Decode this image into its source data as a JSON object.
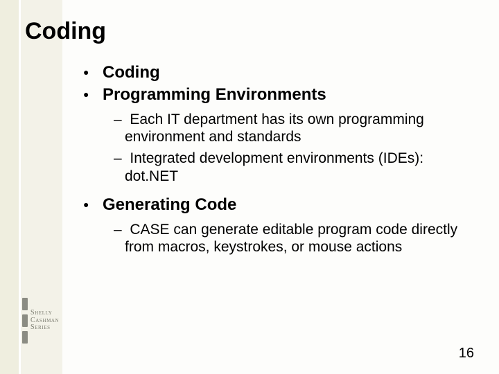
{
  "slide": {
    "title": "Coding",
    "bullets": [
      {
        "text": "Coding",
        "sub": []
      },
      {
        "text": "Programming Environments",
        "sub": [
          "Each IT department has its own programming environment and standards",
          "Integrated development environments (IDEs): dot.NET"
        ]
      },
      {
        "text": "Generating Code",
        "sub": [
          "CASE can generate editable program code directly from macros, keystrokes, or mouse actions"
        ]
      }
    ],
    "page_number": "16",
    "logo": {
      "line1": "Shelly",
      "line2": "Cashman",
      "line3": "Series"
    }
  }
}
